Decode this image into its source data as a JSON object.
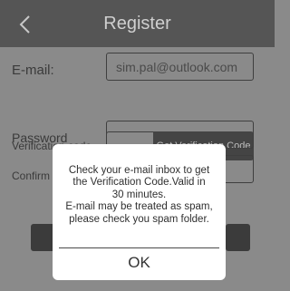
{
  "header": {
    "title": "Register"
  },
  "form": {
    "email": {
      "label": "E-mail:",
      "value": "sim.pal@outlook.com"
    },
    "verification": {
      "label": "Verification code",
      "button_label": "Get Verification Code"
    },
    "password": {
      "label": "Password"
    },
    "confirm": {
      "label": "Confirm"
    }
  },
  "dialog": {
    "message_lines": [
      "Check your e-mail inbox to get",
      "the Verification Code.Valid in",
      "30 minutes.",
      "E-mail may be treated as spam,",
      "please check you spam folder."
    ],
    "ok_label": "OK"
  }
}
